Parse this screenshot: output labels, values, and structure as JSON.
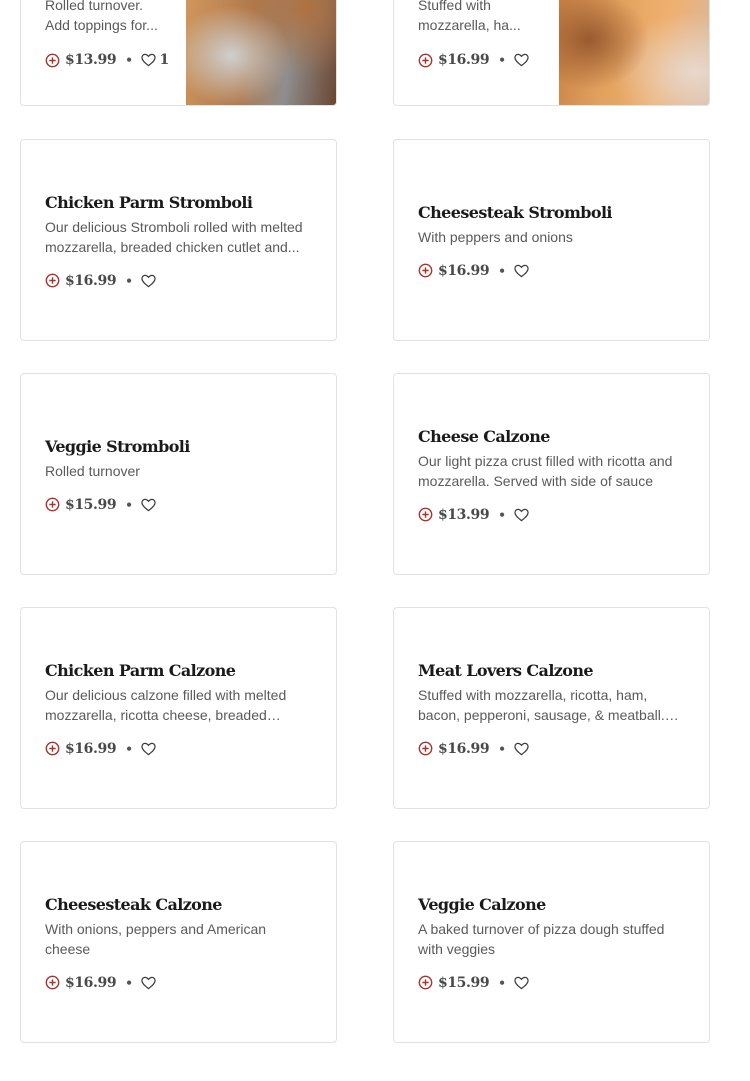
{
  "colors": {
    "accent": "#a8322e",
    "title": "#1a1a1a",
    "text": "#5a5a5a",
    "border": "#e2e2e2"
  },
  "items": [
    {
      "title": "",
      "description": "Rolled turnover. Add toppings for...",
      "price": "$13.99",
      "favorites": "1",
      "image": "dish-photo"
    },
    {
      "title": "",
      "description": "Stuffed with mozzarella, ha...",
      "price": "$16.99",
      "favorites": "",
      "image": "dish-photo"
    },
    {
      "title": "Chicken Parm Stromboli",
      "description": "Our delicious Stromboli rolled with melted mozzarella, breaded chicken cutlet and...",
      "price": "$16.99",
      "favorites": ""
    },
    {
      "title": "Cheesesteak Stromboli",
      "description": "With peppers and onions",
      "price": "$16.99",
      "favorites": ""
    },
    {
      "title": "Veggie Stromboli",
      "description": "Rolled turnover",
      "price": "$15.99",
      "favorites": ""
    },
    {
      "title": "Cheese Calzone",
      "description": "Our light pizza crust filled with ricotta and mozzarella. Served with side of sauce",
      "price": "$13.99",
      "favorites": ""
    },
    {
      "title": "Chicken Parm Calzone",
      "description": "Our delicious calzone filled with melted mozzarella, ricotta cheese, breaded chicken...",
      "price": "$16.99",
      "favorites": ""
    },
    {
      "title": "Meat Lovers Calzone",
      "description": "Stuffed with mozzarella, ricotta, ham, bacon, pepperoni, sausage, & meatball. Served wit...",
      "price": "$16.99",
      "favorites": ""
    },
    {
      "title": "Cheesesteak Calzone",
      "description": "With onions, peppers and American cheese",
      "price": "$16.99",
      "favorites": ""
    },
    {
      "title": "Veggie Calzone",
      "description": "A baked turnover of pizza dough stuffed with veggies",
      "price": "$15.99",
      "favorites": ""
    }
  ]
}
